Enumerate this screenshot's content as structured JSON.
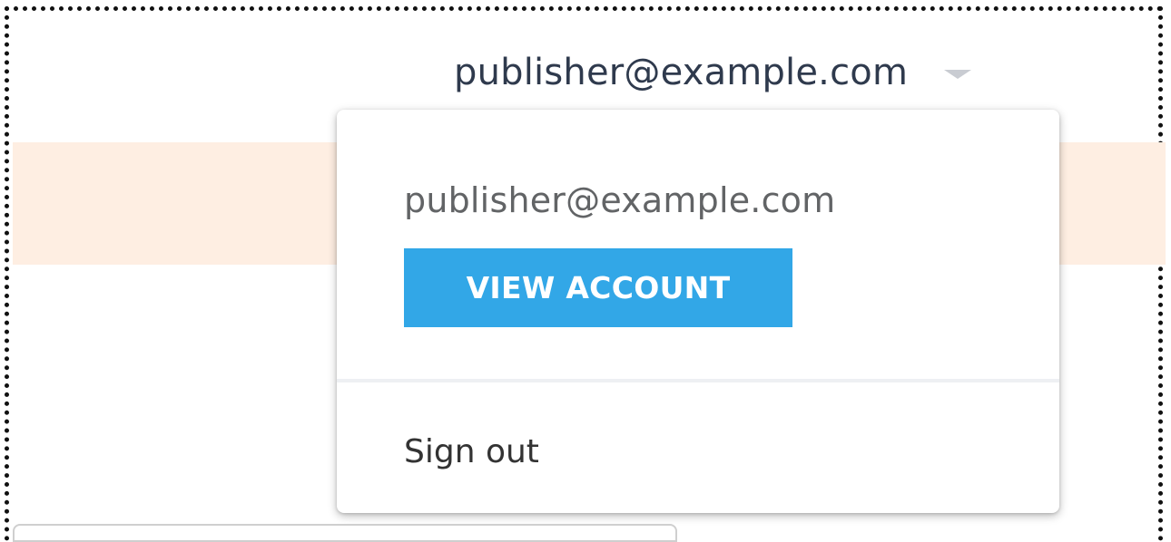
{
  "header": {
    "account_email": "publisher@example.com",
    "caret_icon": "caret-down-icon"
  },
  "account_menu": {
    "email": "publisher@example.com",
    "view_account_label": "VIEW ACCOUNT",
    "sign_out_label": "Sign out"
  },
  "colors": {
    "banner": "#feeee2",
    "primary_button": "#32a7e7",
    "header_text": "#2f3a4d"
  }
}
